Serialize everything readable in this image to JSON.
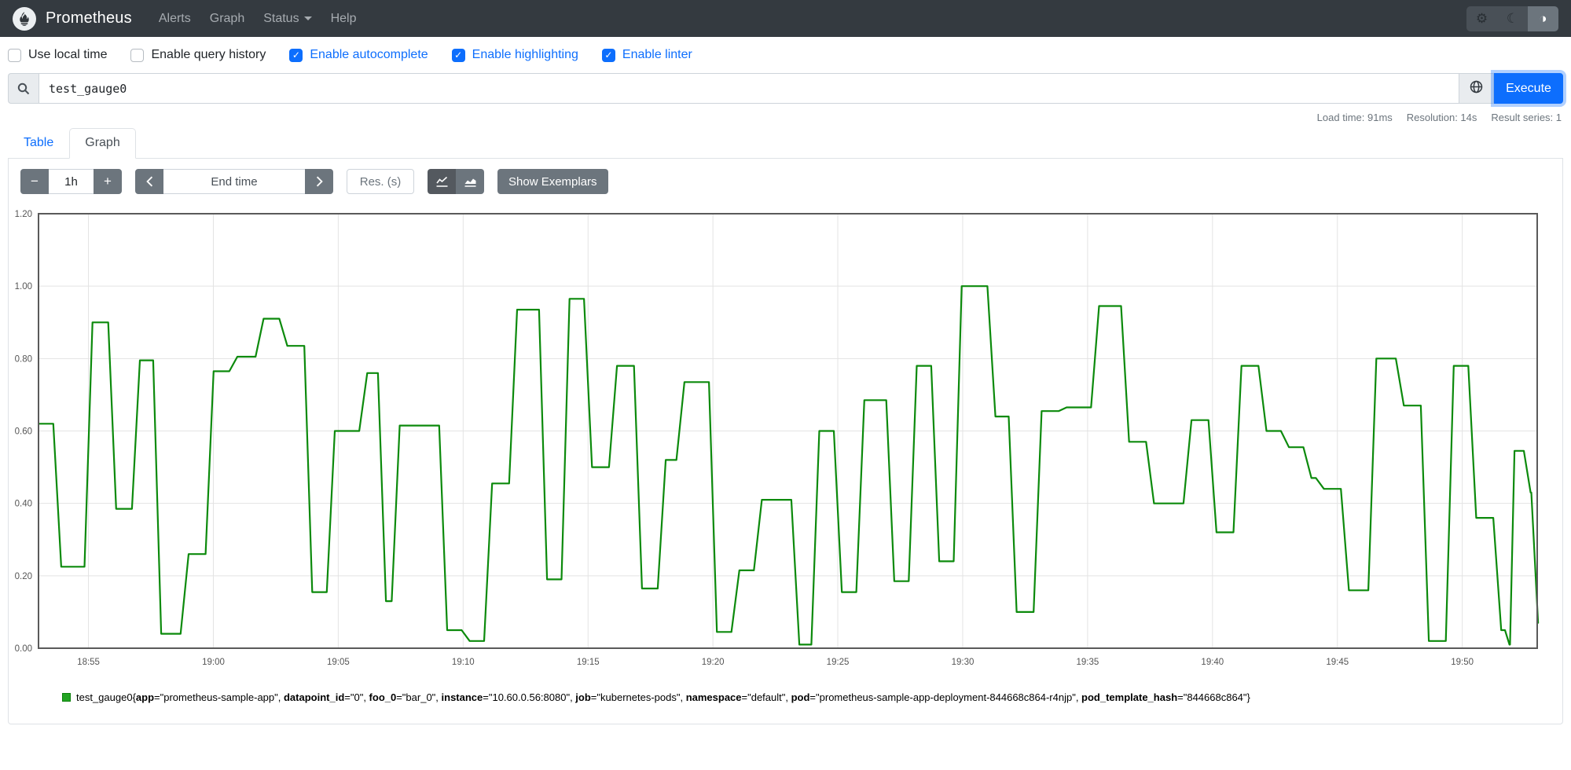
{
  "nav": {
    "title": "Prometheus",
    "links": [
      {
        "label": "Alerts"
      },
      {
        "label": "Graph"
      },
      {
        "label": "Status",
        "dropdown": true
      },
      {
        "label": "Help"
      }
    ],
    "buttons": [
      {
        "icon": "gear-icon",
        "glyph": "⚙"
      },
      {
        "icon": "moon-icon",
        "glyph": "☾"
      },
      {
        "icon": "contrast-icon",
        "glyph": "◑",
        "active": true
      }
    ]
  },
  "options": {
    "items": [
      {
        "label": "Use local time",
        "checked": false
      },
      {
        "label": "Enable query history",
        "checked": false
      },
      {
        "label": "Enable autocomplete",
        "checked": true
      },
      {
        "label": "Enable highlighting",
        "checked": true
      },
      {
        "label": "Enable linter",
        "checked": true
      }
    ],
    "check_glyph": "✓"
  },
  "query": {
    "value": "test_gauge0",
    "execute_label": "Execute"
  },
  "stats": {
    "load_time": "Load time: 91ms",
    "resolution": "Resolution: 14s",
    "result_series": "Result series: 1"
  },
  "tabs": [
    {
      "label": "Table",
      "active": false
    },
    {
      "label": "Graph",
      "active": true
    }
  ],
  "controls": {
    "minus_label": "−",
    "plus_label": "+",
    "range_value": "1h",
    "end_time_placeholder": "End time",
    "res_placeholder": "Res. (s)",
    "show_exemplars_label": "Show Exemplars"
  },
  "chart_data": {
    "type": "line",
    "step": true,
    "title": "",
    "xlabel": "",
    "ylabel": "",
    "grid": true,
    "legend_position": "bottom",
    "x_domain_minutes": 60,
    "x_domain_start_label": "18:53",
    "ylim": [
      0,
      1.2
    ],
    "y_ticks": [
      {
        "v": 0.0,
        "label": "0.00"
      },
      {
        "v": 0.2,
        "label": "0.20"
      },
      {
        "v": 0.4,
        "label": "0.40"
      },
      {
        "v": 0.6,
        "label": "0.60"
      },
      {
        "v": 0.8,
        "label": "0.80"
      },
      {
        "v": 1.0,
        "label": "1.00"
      },
      {
        "v": 1.2,
        "label": "1.20"
      }
    ],
    "x_ticks": [
      {
        "t": 2,
        "label": "18:55"
      },
      {
        "t": 7,
        "label": "19:00"
      },
      {
        "t": 12,
        "label": "19:05"
      },
      {
        "t": 17,
        "label": "19:10"
      },
      {
        "t": 22,
        "label": "19:15"
      },
      {
        "t": 27,
        "label": "19:20"
      },
      {
        "t": 32,
        "label": "19:25"
      },
      {
        "t": 37,
        "label": "19:30"
      },
      {
        "t": 42,
        "label": "19:35"
      },
      {
        "t": 47,
        "label": "19:40"
      },
      {
        "t": 52,
        "label": "19:45"
      },
      {
        "t": 57,
        "label": "19:50"
      }
    ],
    "colors": {
      "line": "#0c8a0c",
      "grid": "#e3e3e3",
      "border": "#5a5a5a",
      "tick_text": "#555555"
    },
    "series": [
      {
        "name": "test_gauge0",
        "color": "#0c8a0c",
        "steps": [
          [
            0.0,
            0.62
          ],
          [
            0.75,
            0.225
          ],
          [
            2.0,
            0.9
          ],
          [
            2.95,
            0.385
          ],
          [
            3.9,
            0.795
          ],
          [
            4.75,
            0.04
          ],
          [
            5.85,
            0.26
          ],
          [
            6.85,
            0.765
          ],
          [
            7.8,
            0.805
          ],
          [
            8.85,
            0.91
          ],
          [
            9.8,
            0.835
          ],
          [
            10.8,
            0.155
          ],
          [
            11.7,
            0.6
          ],
          [
            13.0,
            0.76
          ],
          [
            13.75,
            0.13
          ],
          [
            14.3,
            0.615
          ],
          [
            16.2,
            0.05
          ],
          [
            17.1,
            0.02
          ],
          [
            18.0,
            0.455
          ],
          [
            19.0,
            0.935
          ],
          [
            20.2,
            0.19
          ],
          [
            21.1,
            0.965
          ],
          [
            22.0,
            0.5
          ],
          [
            23.0,
            0.78
          ],
          [
            24.0,
            0.165
          ],
          [
            24.95,
            0.52
          ],
          [
            25.7,
            0.735
          ],
          [
            27.0,
            0.045
          ],
          [
            27.9,
            0.215
          ],
          [
            28.8,
            0.41
          ],
          [
            30.3,
            0.01
          ],
          [
            31.1,
            0.6
          ],
          [
            32.0,
            0.155
          ],
          [
            32.9,
            0.685
          ],
          [
            34.1,
            0.185
          ],
          [
            35.0,
            0.78
          ],
          [
            35.9,
            0.24
          ],
          [
            36.8,
            1.0
          ],
          [
            38.15,
            0.64
          ],
          [
            39.0,
            0.1
          ],
          [
            40.0,
            0.655
          ],
          [
            41.0,
            0.665
          ],
          [
            42.3,
            0.945
          ],
          [
            43.5,
            0.57
          ],
          [
            44.5,
            0.4
          ],
          [
            46.0,
            0.63
          ],
          [
            47.0,
            0.32
          ],
          [
            48.0,
            0.78
          ],
          [
            49.0,
            0.6
          ],
          [
            49.9,
            0.555
          ],
          [
            50.8,
            0.47
          ],
          [
            51.3,
            0.44
          ],
          [
            52.3,
            0.16
          ],
          [
            53.4,
            0.8
          ],
          [
            54.5,
            0.67
          ],
          [
            55.5,
            0.02
          ],
          [
            56.5,
            0.78
          ],
          [
            57.4,
            0.36
          ],
          [
            58.4,
            0.05
          ],
          [
            58.8,
            0.01
          ],
          [
            59.0,
            0.545
          ],
          [
            59.6,
            0.43
          ],
          [
            59.9,
            0.07
          ]
        ]
      }
    ]
  },
  "legend": {
    "metric": "test_gauge0",
    "labels": [
      {
        "name": "app",
        "value": "prometheus-sample-app"
      },
      {
        "name": "datapoint_id",
        "value": "0"
      },
      {
        "name": "foo_0",
        "value": "bar_0"
      },
      {
        "name": "instance",
        "value": "10.60.0.56:8080"
      },
      {
        "name": "job",
        "value": "kubernetes-pods"
      },
      {
        "name": "namespace",
        "value": "default"
      },
      {
        "name": "pod",
        "value": "prometheus-sample-app-deployment-844668c864-r4njp"
      },
      {
        "name": "pod_template_hash",
        "value": "844668c864"
      }
    ]
  }
}
